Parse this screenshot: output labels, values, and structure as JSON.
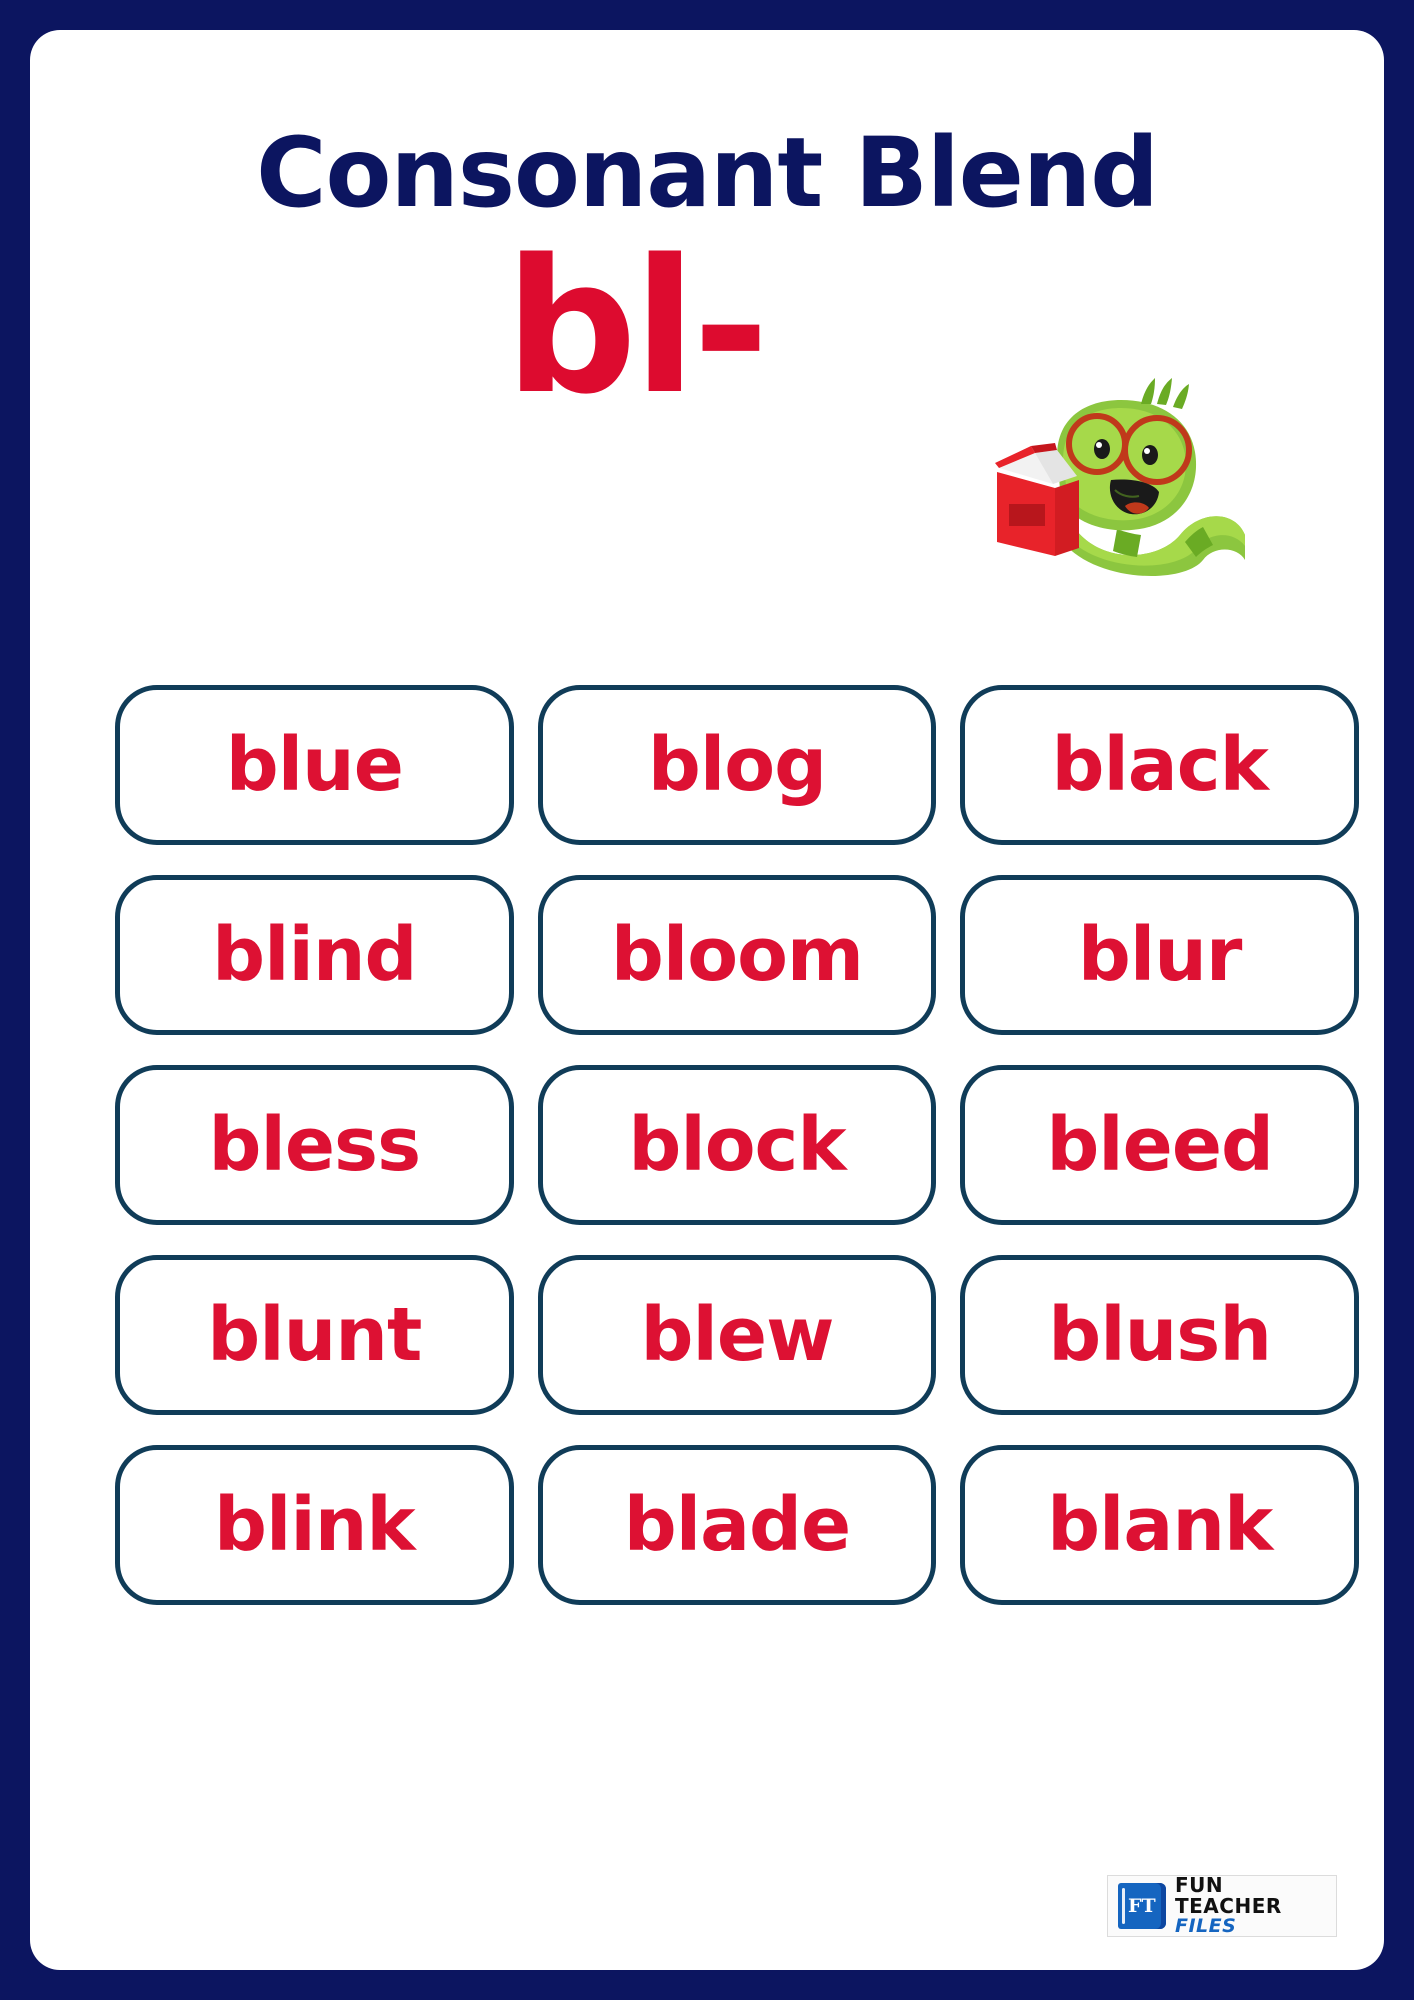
{
  "page": {
    "border_color": "#0c1560",
    "panel_color": "#ffffff"
  },
  "header": {
    "title": "Consonant Blend",
    "blend": "bl-",
    "title_color": "#0c1560",
    "blend_color": "#dd0b2f"
  },
  "illustration": {
    "name": "bookworm-reading-icon",
    "body_color": "#8cc63f",
    "body_light_color": "#a6d94a",
    "body_dark_color": "#6aab24",
    "glasses_color": "#c0391b",
    "book_color": "#e8232a",
    "book_dark_color": "#b8161c"
  },
  "cards": {
    "border_color": "#103c58",
    "word_color": "#dd1133",
    "rows": [
      [
        "blue",
        "blog",
        "black"
      ],
      [
        "blind",
        "bloom",
        "blur"
      ],
      [
        "bless",
        "block",
        "bleed"
      ],
      [
        "blunt",
        "blew",
        "blush"
      ],
      [
        "blink",
        "blade",
        "blank"
      ]
    ]
  },
  "footer": {
    "logo": {
      "mark": "FT",
      "line1": "FUN TEACHER",
      "line2": "FILES",
      "mark_bg": "#1565c0",
      "line1_color": "#111111",
      "line2_color": "#1565c0"
    }
  }
}
